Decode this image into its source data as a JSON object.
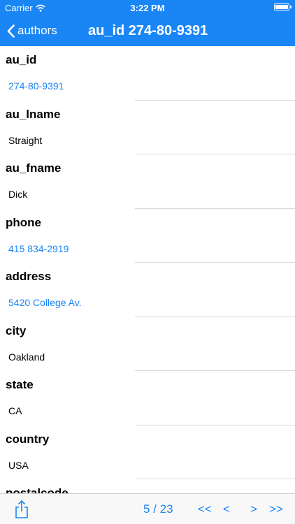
{
  "status_bar": {
    "carrier": "Carrier",
    "time": "3:22 PM",
    "wifi_icon": "wifi-icon",
    "battery_icon": "battery-icon",
    "battery_level": 1.0
  },
  "nav_bar": {
    "back_label": "authors",
    "back_icon": "chevron-left-icon",
    "title": "au_id 274-80-9391"
  },
  "fields": [
    {
      "label": "au_id",
      "value": "274-80-9391"
    },
    {
      "label": "au_lname",
      "value": "Straight"
    },
    {
      "label": "au_fname",
      "value": "Dick"
    },
    {
      "label": "phone",
      "value": "415 834-2919"
    },
    {
      "label": "address",
      "value": "5420 College Av."
    },
    {
      "label": "city",
      "value": "Oakland"
    },
    {
      "label": "state",
      "value": "CA"
    },
    {
      "label": "country",
      "value": "USA"
    },
    {
      "label": "postalcode",
      "value": ""
    }
  ],
  "toolbar": {
    "share_icon": "share-icon",
    "page_indicator": "5 / 23",
    "first_label": "<<",
    "prev_label": "<",
    "next_label": ">",
    "last_label": ">>"
  },
  "colors": {
    "accent": "#1a86f6",
    "toolbar_bg": "#f8f8f8",
    "separator": "#d9d9d9"
  }
}
